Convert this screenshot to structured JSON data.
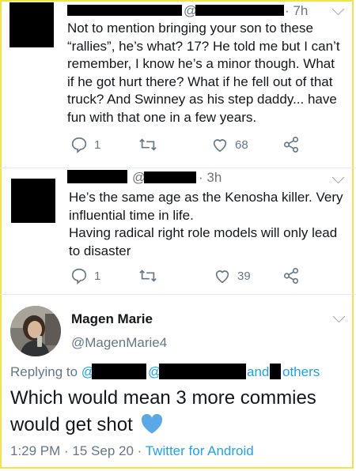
{
  "tweet1": {
    "at": "@",
    "time": "· 7h",
    "lines": [
      "Not to mention bringing your son to these",
      "“rallies”, he’s what? 17? He told me but I can’t",
      "remember, I know he’s a minor though. What",
      "if he got hurt there? What if he fell out of that",
      "truck? And Swinney as his step daddy... have",
      "fun with that one in a few years."
    ],
    "replies": "1",
    "likes": "68"
  },
  "tweet2": {
    "at": "@",
    "time": "· 3h",
    "lines": [
      "He’s the same age as the Kenosha killer. Very",
      "influential time in life.",
      "Having radical right role models will only lead",
      "to disaster"
    ],
    "replies": "1",
    "likes": "39"
  },
  "main": {
    "name": "Magen Marie",
    "handle": "@MagenMarie4",
    "replying_prefix": "Replying to ",
    "at1": "@",
    "at2": "@",
    "and": "and",
    "others": "others",
    "text_lines": [
      "Which would mean 3 more commies",
      "would get shot"
    ],
    "emoji": "blue-heart-icon",
    "time_date": "1:29 PM · 15 Sep 20 · ",
    "source": "Twitter for Android"
  },
  "colors": {
    "accent": "#1da1f2",
    "muted": "#657786",
    "text": "#14171a",
    "heart": "#5aa9e6",
    "frame": "#f4e24a"
  }
}
